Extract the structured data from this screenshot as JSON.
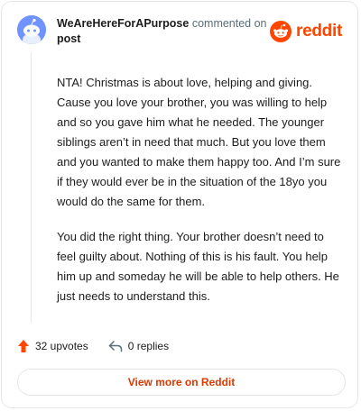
{
  "header": {
    "author": "WeAreHereForAPurpose",
    "action_text": "commented on",
    "post_link": "post",
    "brand": "reddit"
  },
  "comment": {
    "paragraphs": [
      "NTA! Christmas is about love, helping and giving. Cause you love your brother, you was willing to help and so you gave him what he needed. The younger siblings aren’t in need that much. But you love them and you wanted to make them happy too. And I’m sure if they would ever be in the situation of the 18yo you would do the same for them.",
      "You did the right thing. Your brother doesn’t need to feel guilty about. Nothing of this is his fault. You help him up and someday he will be able to help others. He just needs to understand this."
    ]
  },
  "actions": {
    "upvotes": "32 upvotes",
    "replies": "0 replies"
  },
  "footer": {
    "view_more": "View more on Reddit"
  },
  "colors": {
    "brand": "#ff4500",
    "upvote": "#ff4500",
    "avatar": "#7193ff",
    "link": "#d93900"
  }
}
